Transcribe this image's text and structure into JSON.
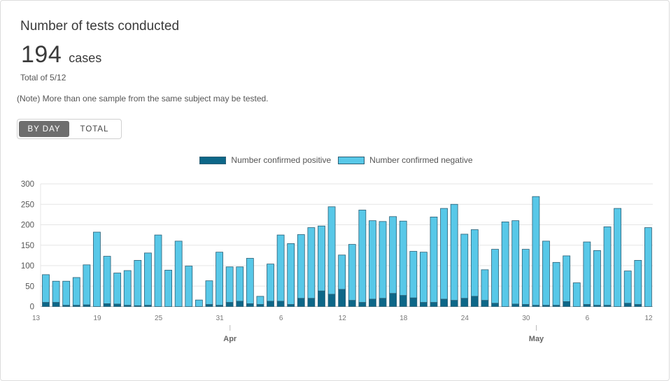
{
  "card": {
    "title": "Number of tests conducted",
    "value": "194",
    "unit": "cases",
    "date": "Total of 5/12",
    "note": "(Note) More than one sample from the same subject may be tested.",
    "toggle": {
      "by_day": "BY DAY",
      "total": "TOTAL",
      "active": "by_day"
    }
  },
  "colors": {
    "positive": "#0d6788",
    "negative": "#58c8e8",
    "outline": "#2c5f75"
  },
  "chart_data": {
    "type": "bar",
    "stacked": true,
    "legend": [
      "Number confirmed positive",
      "Number confirmed negative"
    ],
    "ylim": [
      0,
      300
    ],
    "yticks": [
      0,
      50,
      100,
      150,
      200,
      250,
      300
    ],
    "xtick_labels": [
      "13",
      "19",
      "25",
      "31",
      "6",
      "12",
      "18",
      "24",
      "30",
      "6",
      "12"
    ],
    "month_labels": [
      "Apr",
      "May"
    ],
    "grid": true,
    "x": [
      "3/13",
      "3/14",
      "3/15",
      "3/16",
      "3/17",
      "3/18",
      "3/19",
      "3/20",
      "3/21",
      "3/22",
      "3/23",
      "3/24",
      "3/25",
      "3/26",
      "3/27",
      "3/28",
      "3/29",
      "3/30",
      "3/31",
      "4/1",
      "4/2",
      "4/3",
      "4/4",
      "4/5",
      "4/6",
      "4/7",
      "4/8",
      "4/9",
      "4/10",
      "4/11",
      "4/12",
      "4/13",
      "4/14",
      "4/15",
      "4/16",
      "4/17",
      "4/18",
      "4/19",
      "4/20",
      "4/21",
      "4/22",
      "4/23",
      "4/24",
      "4/25",
      "4/26",
      "4/27",
      "4/28",
      "4/29",
      "4/30",
      "5/1",
      "5/2",
      "5/3",
      "5/4",
      "5/5",
      "5/6",
      "5/7",
      "5/8",
      "5/9",
      "5/10",
      "5/11",
      "5/12"
    ],
    "series": [
      {
        "name": "Number confirmed positive",
        "values": [
          10,
          10,
          3,
          3,
          4,
          0,
          7,
          6,
          3,
          2,
          3,
          0,
          0,
          0,
          0,
          0,
          5,
          3,
          10,
          13,
          7,
          5,
          13,
          13,
          5,
          20,
          20,
          38,
          30,
          42,
          15,
          10,
          18,
          20,
          32,
          27,
          21,
          10,
          10,
          18,
          15,
          20,
          25,
          15,
          8,
          0,
          6,
          5,
          3,
          3,
          3,
          12,
          0,
          5,
          3,
          3,
          0,
          8,
          5,
          0,
          0
        ]
      },
      {
        "name": "Number confirmed negative",
        "values": [
          68,
          52,
          59,
          68,
          98,
          182,
          116,
          76,
          85,
          111,
          128,
          175,
          89,
          160,
          99,
          16,
          58,
          130,
          87,
          84,
          111,
          20,
          91,
          162,
          149,
          156,
          173,
          159,
          214,
          84,
          137,
          226,
          192,
          188,
          188,
          182,
          114,
          123,
          209,
          222,
          235,
          157,
          163,
          75,
          132,
          207,
          204,
          135,
          266,
          157,
          105,
          112,
          58,
          153,
          134,
          192,
          240,
          79,
          108,
          193,
          0
        ]
      }
    ]
  }
}
